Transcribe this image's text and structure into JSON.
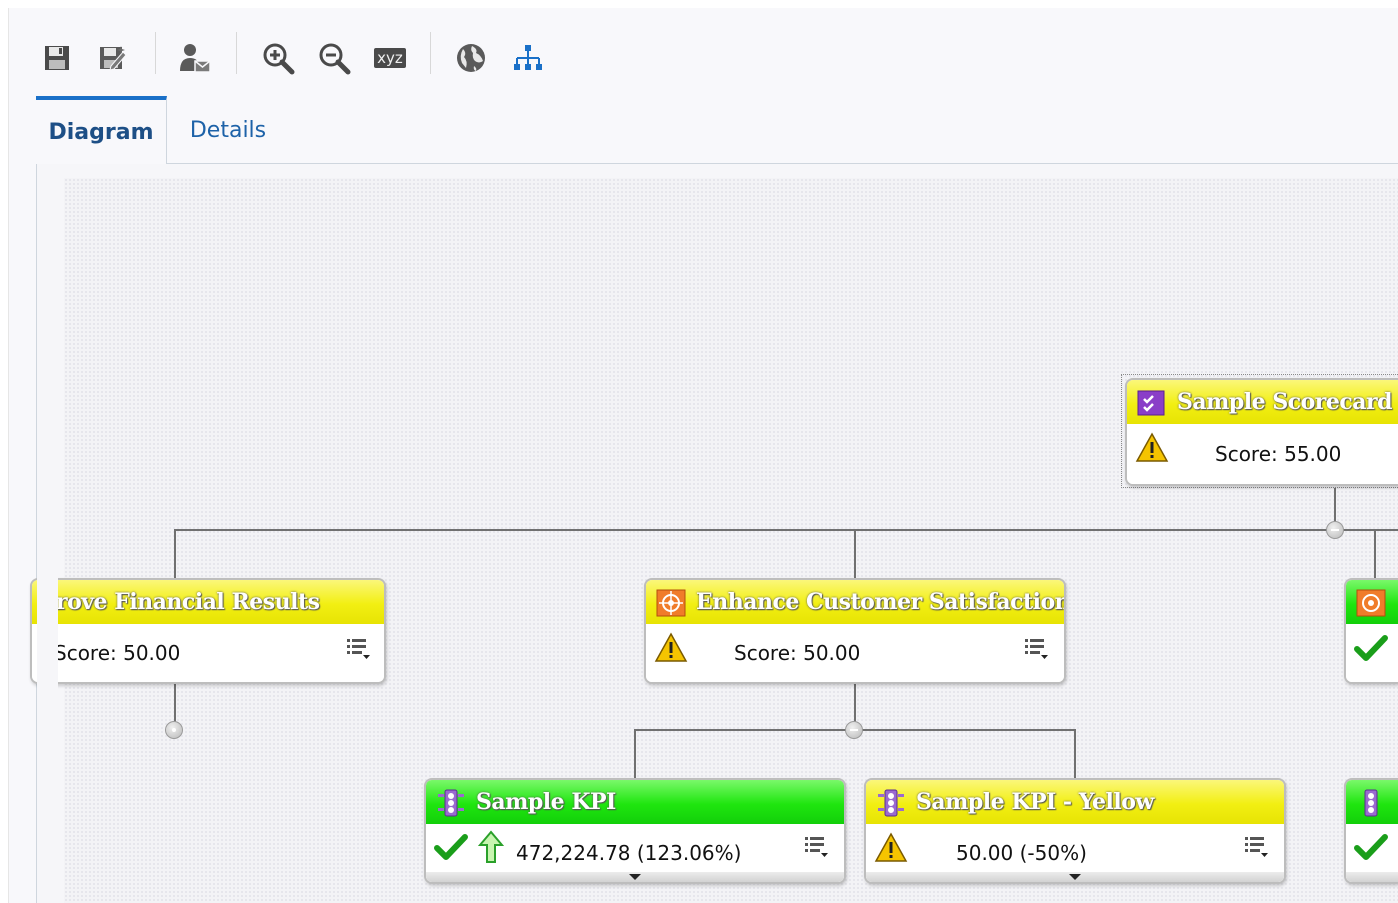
{
  "toolbar": {
    "buttons": [
      {
        "name": "save",
        "icon": "save-icon"
      },
      {
        "name": "save-as",
        "icon": "save-as-icon"
      },
      {
        "name": "assign-user",
        "icon": "user-assign-icon"
      },
      {
        "name": "zoom-in",
        "icon": "zoom-in-icon"
      },
      {
        "name": "zoom-out",
        "icon": "zoom-out-icon"
      },
      {
        "name": "xyz",
        "icon": "xyz-icon",
        "label": "xyz"
      },
      {
        "name": "globe",
        "icon": "globe-icon"
      },
      {
        "name": "hierarchy",
        "icon": "hierarchy-icon"
      }
    ]
  },
  "tabs": [
    {
      "label": "Diagram",
      "active": true
    },
    {
      "label": "Details",
      "active": false
    }
  ],
  "diagram": {
    "root": {
      "title": "Sample Scorecard -",
      "score": "Score: 55.00",
      "status": "warning",
      "color": "yellow",
      "icon": "scorecard-icon"
    },
    "objectives": [
      {
        "title": "rove Financial Results",
        "score": "Score: 50.00",
        "color": "yellow"
      },
      {
        "title": "Enhance Customer Satisfaction",
        "score": "Score: 50.00",
        "status": "warning",
        "color": "yellow",
        "icon": "objective-icon"
      },
      {
        "title": "",
        "status": "ok",
        "color": "green",
        "icon": "objective-icon"
      }
    ],
    "kpis": [
      {
        "title": "Sample KPI",
        "value": "472,224.78 (123.06%)",
        "status": "ok",
        "trend": "up",
        "color": "green",
        "icon": "kpi-icon"
      },
      {
        "title": "Sample KPI - Yellow",
        "value": "50.00 (-50%)",
        "status": "warning",
        "color": "yellow",
        "icon": "kpi-icon"
      },
      {
        "title": "",
        "status": "ok",
        "color": "green",
        "icon": "kpi-icon"
      }
    ]
  },
  "colors": {
    "yellow": "#f2ef12",
    "green": "#1fe60f",
    "tab_accent": "#1a70c8",
    "connector": "#707070"
  }
}
